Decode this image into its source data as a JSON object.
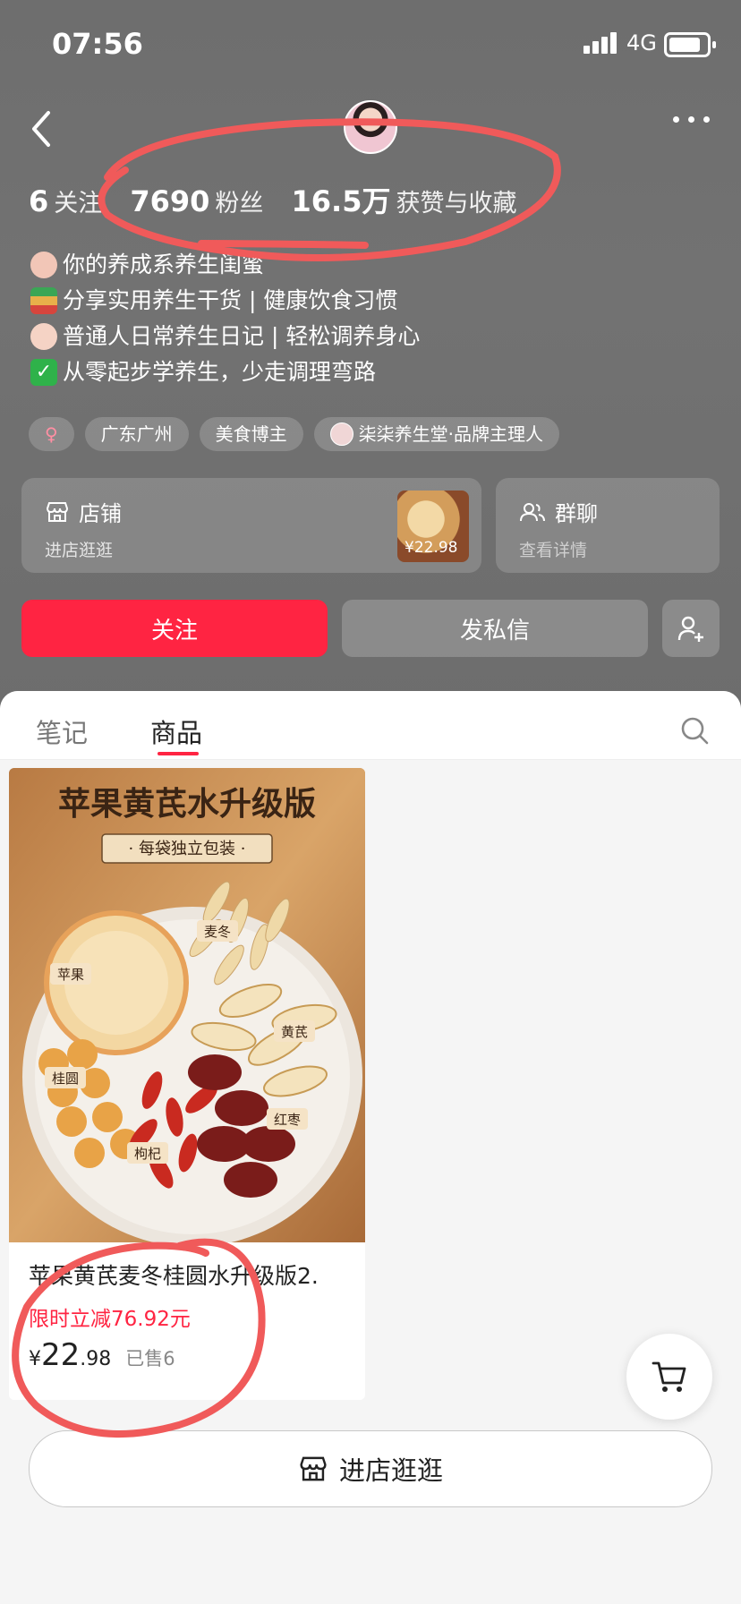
{
  "status_bar": {
    "time": "07:56",
    "network": "4G"
  },
  "profile": {
    "stats": [
      {
        "value": "6",
        "label": "关注"
      },
      {
        "value": "7690",
        "label": "粉丝"
      },
      {
        "value": "16.5万",
        "label": "获赞与收藏"
      }
    ],
    "bio": [
      "你的养成系养生闺蜜",
      "分享实用养生干货 | 健康饮食习惯",
      "普通人日常养生日记 | 轻松调养身心",
      "从零起步学养生，少走调理弯路"
    ],
    "tags": [
      "♀",
      "广东广州",
      "美食博主",
      "柒柒养生堂·品牌主理人"
    ]
  },
  "cards": {
    "shop": {
      "title": "店铺",
      "subtitle": "进店逛逛",
      "thumb_price": "¥22.98"
    },
    "group": {
      "title": "群聊",
      "subtitle": "查看详情"
    }
  },
  "actions": {
    "follow": "关注",
    "message": "发私信"
  },
  "tabs": [
    {
      "label": "笔记"
    },
    {
      "label": "商品"
    }
  ],
  "product": {
    "image_title": "苹果黄芪水升级版",
    "image_subtitle": "· 每袋独立包装 ·",
    "ingredients": [
      "苹果",
      "麦冬",
      "黄芪",
      "桂圆",
      "枸杞",
      "红枣"
    ],
    "title": "苹果黄芪麦冬桂圆水升级版2.",
    "promo": "限时立减76.92元",
    "price_currency": "¥",
    "price_int": "22",
    "price_dec": ".98",
    "sold": "已售6"
  },
  "footer": {
    "shop_button": "进店逛逛"
  },
  "colors": {
    "accent": "#ff2442",
    "annotation": "#f05a5a"
  }
}
